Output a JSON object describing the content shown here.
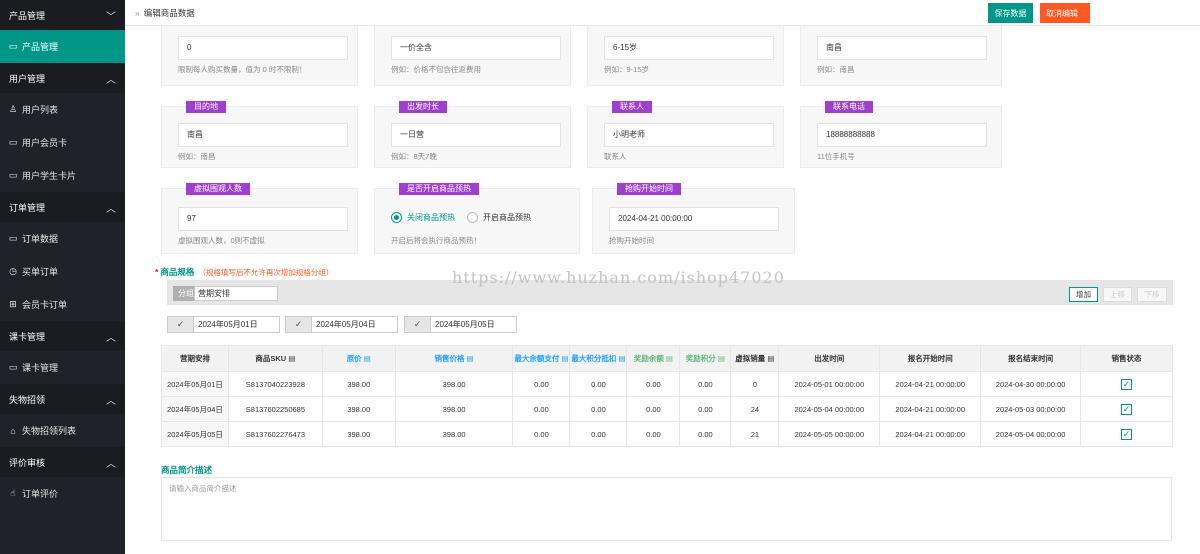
{
  "sidebar": {
    "groups": [
      {
        "label": "产品管理",
        "items": [
          {
            "label": "产品管理",
            "icon": "calendar-icon",
            "active": true
          }
        ]
      },
      {
        "label": "用户管理",
        "items": [
          {
            "label": "用户列表",
            "icon": "user-icon"
          },
          {
            "label": "用户会员卡",
            "icon": "card-icon"
          },
          {
            "label": "用户学生卡片",
            "icon": "card-icon"
          }
        ]
      },
      {
        "label": "订单管理",
        "items": [
          {
            "label": "订单数据",
            "icon": "calendar-icon"
          },
          {
            "label": "买单订单",
            "icon": "clock-icon"
          },
          {
            "label": "会员卡订单",
            "icon": "gift-icon"
          }
        ]
      },
      {
        "label": "课卡管理",
        "items": [
          {
            "label": "课卡管理",
            "icon": "card-icon"
          }
        ]
      },
      {
        "label": "失物招领",
        "items": [
          {
            "label": "失物招领列表",
            "icon": "home-icon"
          }
        ]
      },
      {
        "label": "评价审核",
        "items": [
          {
            "label": "订单评价",
            "icon": "hand-icon"
          }
        ]
      }
    ]
  },
  "topbar": {
    "breadcrumb": "编辑商品数据",
    "save_label": "保存数据",
    "cancel_label": "取消编辑"
  },
  "row1": [
    {
      "value": "0",
      "hint": "限制每人购买数量，值为 0 时不限制！"
    },
    {
      "value": "一价全含",
      "hint": "例如：价格不包含往返费用"
    },
    {
      "value": "6-15岁",
      "hint": "例如：9-15岁"
    },
    {
      "value": "南昌",
      "hint": "例如：南昌"
    }
  ],
  "row2": [
    {
      "tag": "目的地",
      "value": "南昌",
      "hint": "例如：南昌"
    },
    {
      "tag": "出发时长",
      "value": "一日营",
      "hint": "例如：8天7晚"
    },
    {
      "tag": "联系人",
      "value": "小明老师",
      "hint": "联系人"
    },
    {
      "tag": "联系电话",
      "value": "18888888888",
      "hint": "11位手机号"
    }
  ],
  "row3": {
    "virtual": {
      "tag": "虚拟围观人数",
      "value": "97",
      "hint": "虚拟围观人数，0则不虚拟"
    },
    "preheat": {
      "tag": "是否开启商品预热",
      "option_off": "关闭商品预热",
      "option_on": "开启商品预热",
      "hint": "开启后将会执行商品预热！"
    },
    "start": {
      "tag": "抢购开始时间",
      "value": "2024-04-21 00:00:00",
      "hint": "抢购开始时间"
    }
  },
  "spec": {
    "title": "商品规格",
    "note": "（规格填写后不允许再次增加规格分组）",
    "group_label": "分组",
    "group_value": "营期安排",
    "add": "增加",
    "up": "上移",
    "down": "下移",
    "dates": [
      "2024年05月01日",
      "2024年05月04日",
      "2024年05月05日"
    ],
    "headers": [
      "营期安排",
      "商品SKU",
      "原价",
      "销售价格",
      "最大余额支付",
      "最大积分抵扣",
      "奖励余额",
      "奖励积分",
      "虚拟销量",
      "出发时间",
      "报名开始时间",
      "报名结束时间",
      "销售状态"
    ],
    "rows": [
      [
        "2024年05月01日",
        "S8137040223928",
        "398.00",
        "398.00",
        "0.00",
        "0.00",
        "0.00",
        "0.00",
        "0",
        "2024-05-01 00:00:00",
        "2024-04-21 00:00:00",
        "2024-04-30 00:00:00"
      ],
      [
        "2024年05月04日",
        "S8137602250685",
        "398.00",
        "398.00",
        "0.00",
        "0.00",
        "0.00",
        "0.00",
        "24",
        "2024-05-04 00:00:00",
        "2024-04-21 00:00:00",
        "2024-05-03 00:00:00"
      ],
      [
        "2024年05月05日",
        "S8137602276473",
        "398.00",
        "398.00",
        "0.00",
        "0.00",
        "0.00",
        "0.00",
        "21",
        "2024-05-05 00:00:00",
        "2024-04-21 00:00:00",
        "2024-05-04 00:00:00"
      ]
    ]
  },
  "desc": {
    "title": "商品简介描述",
    "placeholder": "请输入商品简介描述"
  },
  "watermark": "https://www.huzhan.com/ishop47020",
  "colors": {
    "accent": "#009688",
    "tag": "#9e3fcf",
    "danger": "#ff5722",
    "sidebar": "#20222a"
  }
}
